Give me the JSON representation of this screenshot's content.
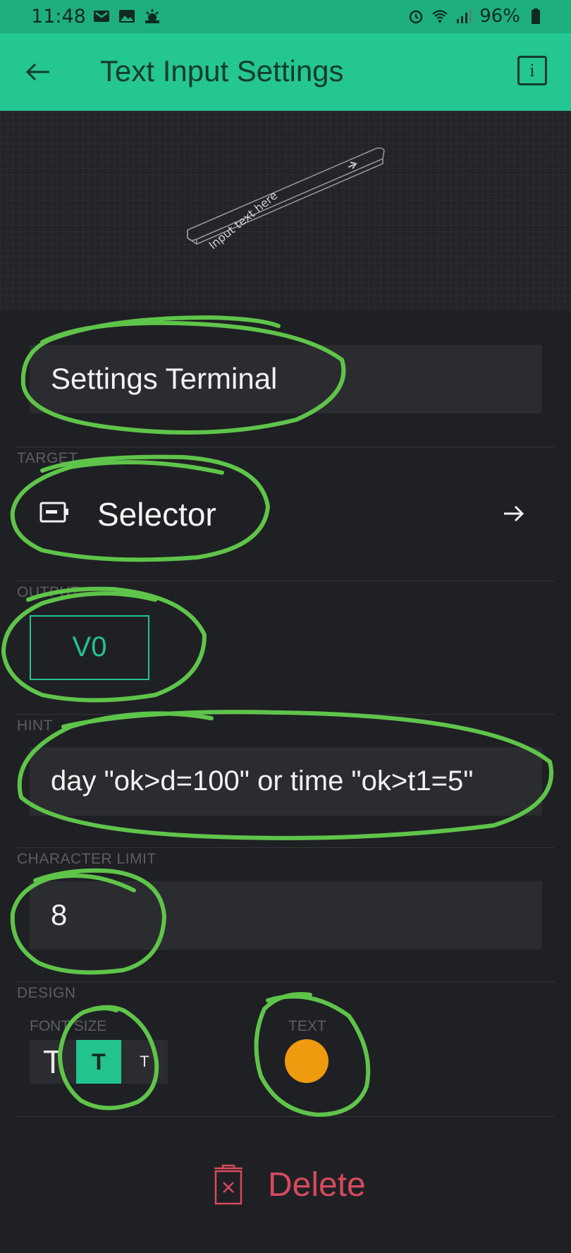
{
  "status_bar": {
    "time": "11:48",
    "battery": "96%",
    "left_icons": [
      "gmail-icon",
      "image-icon",
      "weather-icon"
    ],
    "right_icons": [
      "alarm-icon",
      "wifi-icon",
      "signal-icon",
      "battery-icon"
    ]
  },
  "app_bar": {
    "title": "Text Input Settings",
    "back_icon": "back-arrow-icon",
    "info_icon": "info-icon",
    "info_label": "i",
    "color": "#24c691"
  },
  "preview": {
    "placeholder": "Input text here"
  },
  "name_field": {
    "value": "Settings Terminal"
  },
  "target": {
    "label": "TARGET",
    "value": "Selector",
    "icon": "device-selector-icon",
    "arrow_icon": "arrow-right-icon"
  },
  "output": {
    "label": "OUTPUT",
    "pin": "V0",
    "color": "#23c38e"
  },
  "hint": {
    "label": "HINT",
    "value": "day \"ok>d=100\"  or  time  \"ok>t1=5\""
  },
  "character_limit": {
    "label": "CHARACTER LIMIT",
    "value": "8"
  },
  "design": {
    "label": "DESIGN",
    "font_size_label": "FONT SIZE",
    "font_size_options": [
      "T",
      "T",
      "T"
    ],
    "font_size_selected": 1,
    "text_color_label": "TEXT",
    "text_color": "#ef9b0f"
  },
  "delete": {
    "label": "Delete",
    "icon": "trash-icon",
    "color": "#d64a5d"
  }
}
